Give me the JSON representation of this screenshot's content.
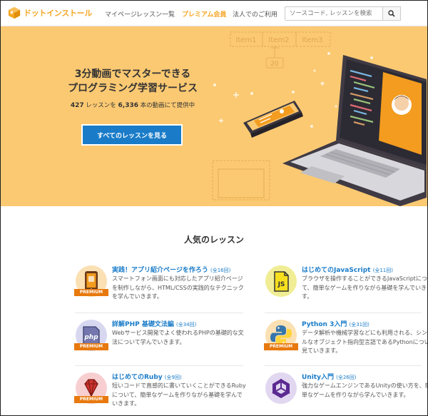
{
  "header": {
    "logo_text": "ドットインストール",
    "nav": [
      "マイページ",
      "レッスン一覧",
      "プレミアム会員",
      "法人でのご利用"
    ],
    "search_placeholder": "ソースコード, レッスンを検索"
  },
  "hero": {
    "title_line1": "3分動画でマスターできる",
    "title_line2": "プログラミング学習サービス",
    "lessons_count": "427",
    "lessons_suffix": " レッスンを ",
    "videos_count": "6,336",
    "videos_suffix": " 本の動画にて提供中",
    "cta_label": "すべてのレッスンを見る",
    "illustration": {
      "tabs": [
        "Item1",
        "Item2",
        "Item3"
      ],
      "number": "20"
    }
  },
  "lessons_section": {
    "title": "人気のレッスン",
    "premium_badge": "PREMIUM",
    "items": [
      {
        "title": "実践！アプリ紹介ページを作ろう",
        "count": "(全16回)",
        "desc": "スマートフォン画面にも対応したアプリ紹介ページを制作しながら、HTML/CSSの実践的なテクニックを学んでいきます。",
        "premium": true,
        "icon": "smartphone-icon",
        "icon_bg": "#fbe0b4"
      },
      {
        "title": "はじめてのJavaScript",
        "count": "(全11回)",
        "desc": "ブラウザを操作することができるJavaScriptについて、簡単なゲームを作りながら基礎を学んでいきます。",
        "premium": false,
        "icon": "js-icon",
        "icon_bg": "#f0ed94"
      },
      {
        "title": "詳解PHP 基礎文法編",
        "count": "(全34回)",
        "desc": "Webサービス開発でよく使われるPHPの基礎的な文法について学んでいきます。",
        "premium": true,
        "icon": "php-icon",
        "icon_bg": "#d7d8f0"
      },
      {
        "title": "Python 3入門",
        "count": "(全31回)",
        "desc": "データ解析や機械学習などにも利用される、シンプルなオブジェクト指向型言語であるPythonについて見ていきます。",
        "premium": true,
        "icon": "python-icon",
        "icon_bg": "#fbe0b4"
      },
      {
        "title": "はじめてのRuby",
        "count": "(全9回)",
        "desc": "短いコードで直感的に書いていくことができるRubyについて、簡単なゲームを作りながら基礎を学んでいきます。",
        "premium": true,
        "icon": "ruby-icon",
        "icon_bg": "#f8cfd1"
      },
      {
        "title": "Unity入門",
        "count": "(全26回)",
        "desc": "強力なゲームエンジンであるUnityの使い方を、簡単なゲームを作りながら学んでいきます。",
        "premium": false,
        "icon": "unity-icon",
        "icon_bg": "#e1d7f0"
      }
    ]
  },
  "colors": {
    "brand": "#f5a623",
    "hero_bg": "#fbc972",
    "link": "#1a7cc8",
    "premium": "#e8790e"
  }
}
